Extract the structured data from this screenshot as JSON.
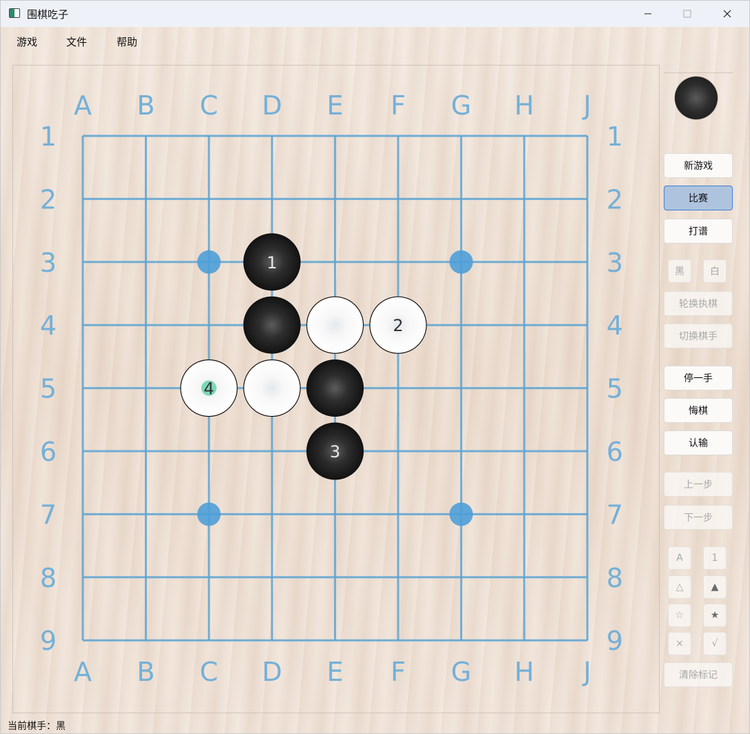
{
  "window": {
    "title": "围棋吃子",
    "icon": "go-board-icon"
  },
  "window_controls": {
    "minimize": "—",
    "maximize": "□",
    "close": "✕"
  },
  "menu": [
    "游戏",
    "文件",
    "帮助"
  ],
  "board": {
    "columns": [
      "A",
      "B",
      "C",
      "D",
      "E",
      "F",
      "G",
      "H",
      "J"
    ],
    "rows": [
      "1",
      "2",
      "3",
      "4",
      "5",
      "6",
      "7",
      "8",
      "9"
    ],
    "line_color": "#5aa3d3",
    "label_color": "#74b0d8",
    "star_points": [
      "C3",
      "G3",
      "C7",
      "G7"
    ],
    "stones": [
      {
        "point": "D3",
        "color": "black",
        "label": "1"
      },
      {
        "point": "D4",
        "color": "black",
        "label": ""
      },
      {
        "point": "E4",
        "color": "white",
        "label": ""
      },
      {
        "point": "F4",
        "color": "white",
        "label": "2"
      },
      {
        "point": "C5",
        "color": "white",
        "label": "4",
        "last_move": true
      },
      {
        "point": "D5",
        "color": "white",
        "label": ""
      },
      {
        "point": "E5",
        "color": "black",
        "label": ""
      },
      {
        "point": "E6",
        "color": "black",
        "label": "3"
      }
    ]
  },
  "side_panel": {
    "current_turn_stone": "black",
    "buttons": {
      "new_game": "新游戏",
      "match": "比赛",
      "record": "打谱",
      "black": "黑",
      "white": "白",
      "rotate": "轮换执棋",
      "switch_player": "切换棋手",
      "pass": "停一手",
      "undo": "悔棋",
      "resign": "认输",
      "prev": "上一步",
      "next": "下一步",
      "mark_letter": "A",
      "mark_number": "1",
      "mark_triangle": "△",
      "mark_triangle_filled": "▲",
      "mark_star": "☆",
      "mark_star_filled": "★",
      "mark_cross": "×",
      "mark_check": "√",
      "clear_marks": "清除标记"
    }
  },
  "status_bar": {
    "text": "当前棋手：黑"
  }
}
